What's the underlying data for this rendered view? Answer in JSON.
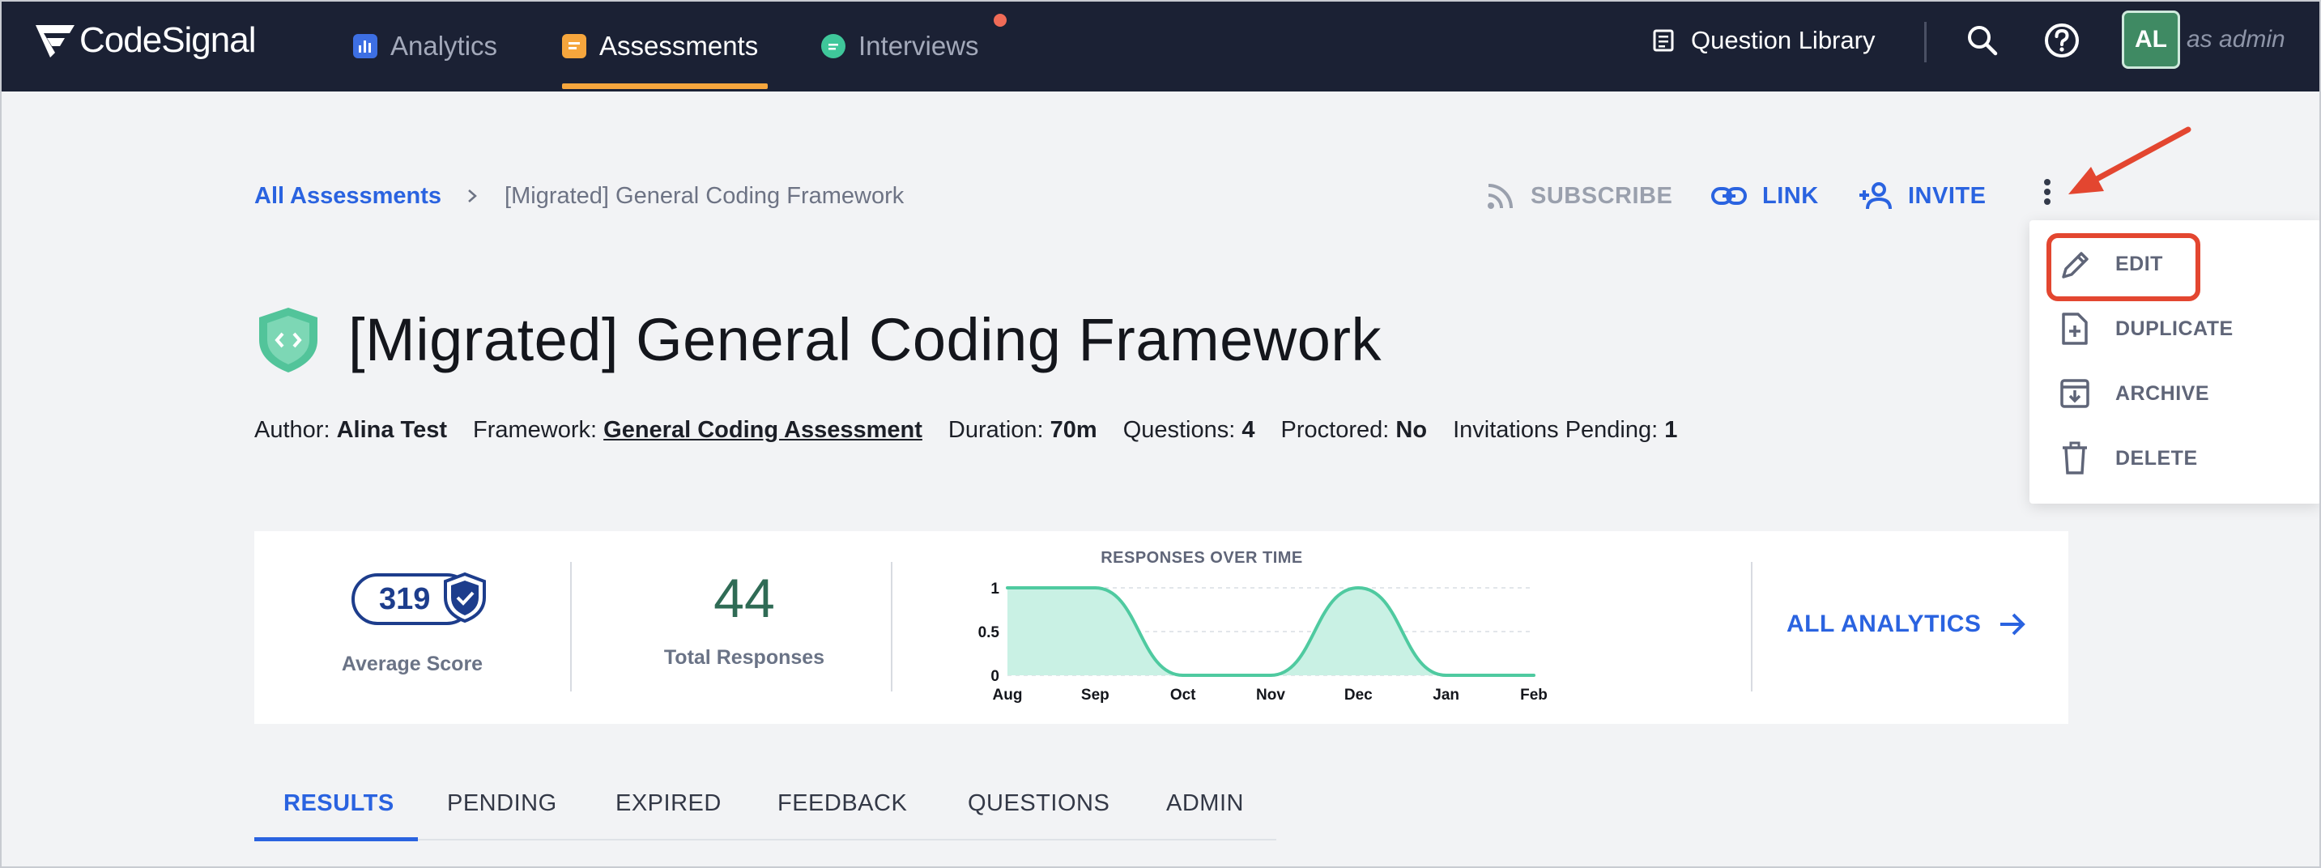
{
  "nav": {
    "logo_text": "CodeSignal",
    "items": [
      {
        "label": "Analytics",
        "icon": "bar-chart-icon",
        "active": false
      },
      {
        "label": "Assessments",
        "icon": "assessment-icon",
        "active": true
      },
      {
        "label": "Interviews",
        "icon": "chat-bubble-icon",
        "active": false
      }
    ],
    "question_library": "Question Library",
    "avatar_initials": "AL",
    "role_text": "as admin"
  },
  "breadcrumb": {
    "root": "All Assessments",
    "current": "[Migrated] General Coding Framework"
  },
  "actions": {
    "subscribe": "SUBSCRIBE",
    "link": "LINK",
    "invite": "INVITE"
  },
  "menu": {
    "items": [
      {
        "label": "EDIT",
        "icon": "pencil-icon"
      },
      {
        "label": "DUPLICATE",
        "icon": "file-plus-icon"
      },
      {
        "label": "ARCHIVE",
        "icon": "archive-icon"
      },
      {
        "label": "DELETE",
        "icon": "trash-icon"
      }
    ]
  },
  "assessment": {
    "title": "[Migrated] General Coding Framework",
    "meta": {
      "author_label": "Author:",
      "author": "Alina Test",
      "framework_label": "Framework:",
      "framework": "General Coding Assessment",
      "duration_label": "Duration:",
      "duration": "70m",
      "questions_label": "Questions:",
      "questions": "4",
      "proctored_label": "Proctored:",
      "proctored": "No",
      "pending_label": "Invitations Pending:",
      "pending": "1"
    }
  },
  "stats": {
    "average_score": "319",
    "average_score_label": "Average Score",
    "total_responses": "44",
    "total_responses_label": "Total Responses",
    "all_analytics": "ALL ANALYTICS"
  },
  "chart_data": {
    "type": "area",
    "title": "RESPONSES OVER TIME",
    "x": [
      "Aug",
      "Sep",
      "Oct",
      "Nov",
      "Dec",
      "Jan",
      "Feb"
    ],
    "values": [
      1,
      1,
      0,
      0,
      1,
      0,
      0
    ],
    "yticks": [
      "0",
      "0.5",
      "1"
    ],
    "ylim": [
      0,
      1
    ],
    "grid": true,
    "fill_color": "#c9f1e4",
    "line_color": "#4fcaa0"
  },
  "tabs": [
    {
      "label": "RESULTS",
      "active": true
    },
    {
      "label": "PENDING",
      "active": false
    },
    {
      "label": "EXPIRED",
      "active": false
    },
    {
      "label": "FEEDBACK",
      "active": false
    },
    {
      "label": "QUESTIONS",
      "active": false
    },
    {
      "label": "ADMIN",
      "active": false
    }
  ],
  "colors": {
    "nav_bg": "#1b2134",
    "accent_blue": "#2a63e0",
    "assessments_underline": "#f6a63d",
    "annotation_red": "#e34630",
    "avatar_green": "#3f8a63"
  }
}
